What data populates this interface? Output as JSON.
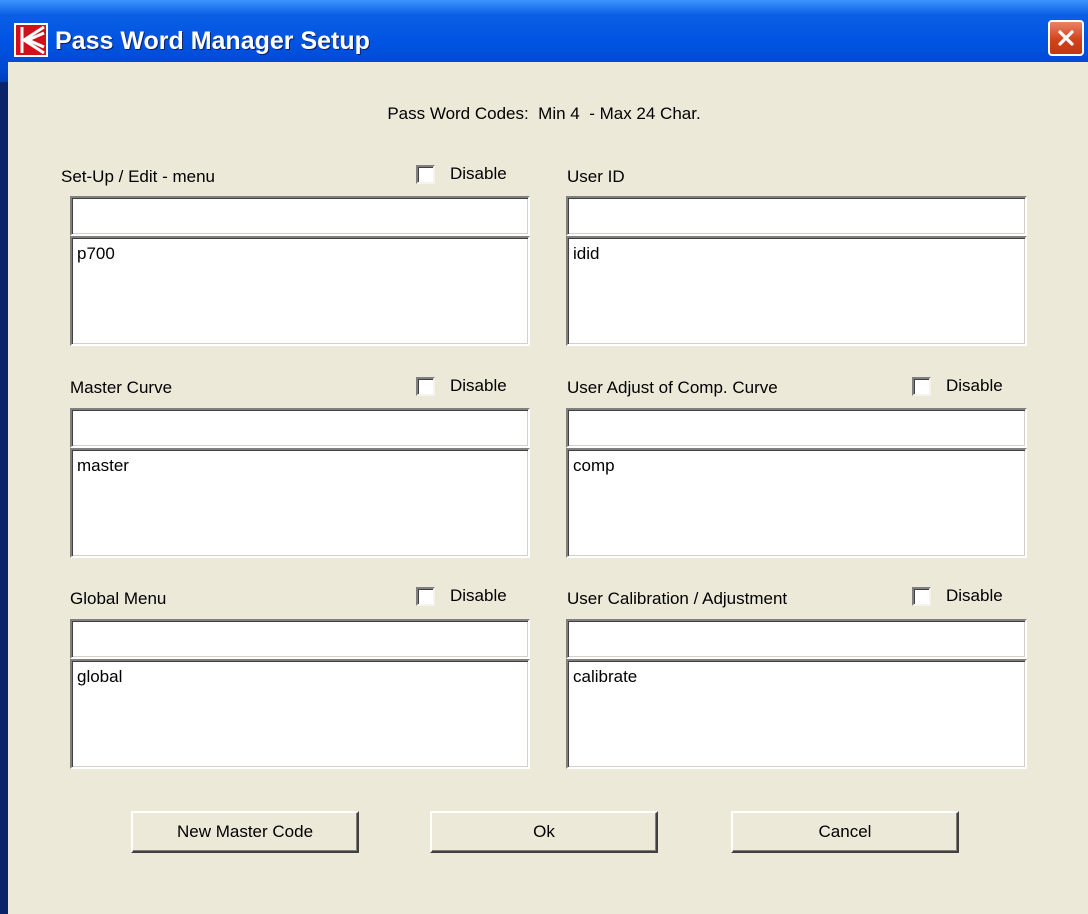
{
  "window": {
    "title": "Pass Word Manager Setup",
    "close_icon": "close-icon"
  },
  "hint": "Pass Word Codes:  Min 4  - Max 24 Char.",
  "sections": {
    "setup": {
      "label": "Set-Up / Edit - menu",
      "disable": "Disable",
      "input": "",
      "memo": "p700"
    },
    "userid": {
      "label": "User ID",
      "input": "",
      "memo": "idid"
    },
    "master": {
      "label": "Master Curve",
      "disable": "Disable",
      "input": "",
      "memo": "master"
    },
    "comp": {
      "label": "User Adjust of Comp. Curve",
      "disable": "Disable",
      "input": "",
      "memo": "comp"
    },
    "global": {
      "label": "Global Menu",
      "disable": "Disable",
      "input": "",
      "memo": "global"
    },
    "calib": {
      "label": "User Calibration / Adjustment",
      "disable": "Disable",
      "input": "",
      "memo": "calibrate"
    }
  },
  "buttons": {
    "new_master": "New Master Code",
    "ok": "Ok",
    "cancel": "Cancel"
  }
}
